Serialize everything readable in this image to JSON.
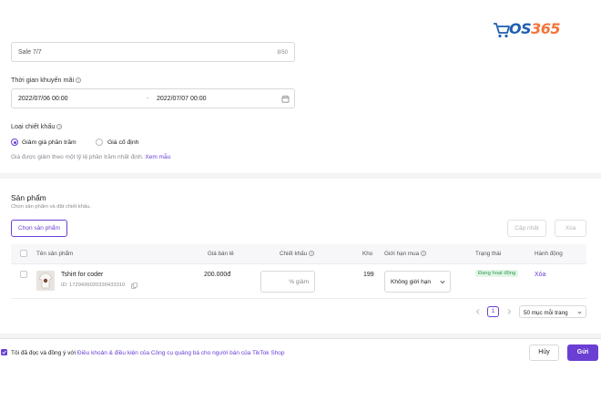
{
  "brand": {
    "logo_prefix": "P",
    "logo_os": "OS",
    "logo_num": "365"
  },
  "promo": {
    "name_value": "Sale 7/7",
    "name_counter": "8/50",
    "time_label": "Thời gian khuyến mãi",
    "start": "2022/07/06 00:00",
    "separator": "-",
    "end": "2022/07/07 00:00",
    "discount_type_label": "Loại chiết khấu",
    "option_percent": "Giảm giá phần trăm",
    "option_fixed": "Giá cố định",
    "hint": "Giá được giảm theo một tỷ lệ phần trăm nhất định.",
    "hint_link": "Xem mẫu"
  },
  "products": {
    "title": "Sản phẩm",
    "subtitle": "Chọn sản phẩm và đặt chiết khấu.",
    "select_button": "Chọn sản phẩm",
    "update_button": "Cập nhật",
    "delete_button": "Xóa",
    "columns": {
      "name": "Tên sản phẩm",
      "price": "Giá bán lẻ",
      "discount": "Chiết khấu",
      "stock": "Kho",
      "limit": "Giới hạn mua",
      "status": "Trạng thái",
      "action": "Hành động"
    },
    "rows": [
      {
        "name": "Tshirt for coder",
        "id": "ID: 1729436020330433310",
        "price": "200.000đ",
        "discount_placeholder": "% giảm",
        "stock": "199",
        "limit": "Không giới hạn",
        "status": "Đang hoạt động",
        "action": "Xóa"
      }
    ],
    "pagination": {
      "page": "1",
      "page_size": "50 mục mỗi trang"
    }
  },
  "footer": {
    "agree_text": "Tôi đã đọc và đồng ý với",
    "agree_link": "Điều khoản & điều kiện của Công cụ quảng bá cho người bán của TikTok Shop",
    "cancel": "Hủy",
    "submit": "Gửi"
  },
  "colors": {
    "accent": "#6b3fd4",
    "status_green": "#2e9b4c",
    "logo_blue": "#1f5fb0",
    "logo_orange": "#f2743a"
  }
}
